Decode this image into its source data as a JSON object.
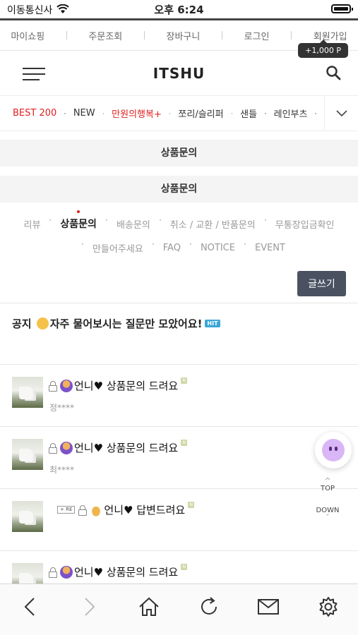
{
  "status": {
    "carrier": "이동통신사",
    "time": "오후 6:24"
  },
  "top_links": [
    "마이쇼핑",
    "주문조회",
    "장바구니",
    "로그인",
    "회원가입"
  ],
  "point_badge": "+1,000 P",
  "header": {
    "logo": "ITSHU"
  },
  "categories": [
    {
      "label": "BEST 200",
      "red": true
    },
    {
      "label": "NEW",
      "red": false
    },
    {
      "label": "만원의행복+",
      "red": true
    },
    {
      "label": "쪼리/슬리퍼",
      "red": false
    },
    {
      "label": "샌들",
      "red": false
    },
    {
      "label": "레인부츠",
      "red": false
    }
  ],
  "section_bars": [
    "상품문의",
    "상품문의"
  ],
  "board_tabs": {
    "row1": [
      "리뷰",
      "상품문의",
      "배송문의",
      "취소 / 교환 / 반품문의",
      "무통장입금확인"
    ],
    "row2": [
      "만들어주세요",
      "FAQ",
      "NOTICE",
      "EVENT"
    ],
    "active": "상품문의"
  },
  "write_button": "글쓰기",
  "notice": {
    "prefix": "공지",
    "text": "자주 물어보시는 질문만 모았어요!",
    "badge": "HIT"
  },
  "posts": [
    {
      "title": "언니♥ 상품문의 드려요",
      "author": "정****",
      "icon": "person-raising-hand",
      "reply": false,
      "new_badge": "N"
    },
    {
      "title": "언니♥ 상품문의 드려요",
      "author": "최****",
      "icon": "person-raising-hand",
      "reply": false,
      "new_badge": "N"
    },
    {
      "title": "언니♥ 답변드려요",
      "author": "",
      "icon": "folded-hands",
      "reply": true,
      "reply_badge": "+ RE",
      "new_badge": "N"
    },
    {
      "title": "언니♥ 상품문의 드려요",
      "author": "",
      "icon": "person-raising-hand",
      "reply": false,
      "new_badge": "N"
    }
  ],
  "scroll_controls": {
    "top": "TOP",
    "down": "DOWN"
  },
  "bottom_nav": [
    "back-icon",
    "forward-icon",
    "home-icon",
    "refresh-icon",
    "mail-icon",
    "settings-icon"
  ]
}
